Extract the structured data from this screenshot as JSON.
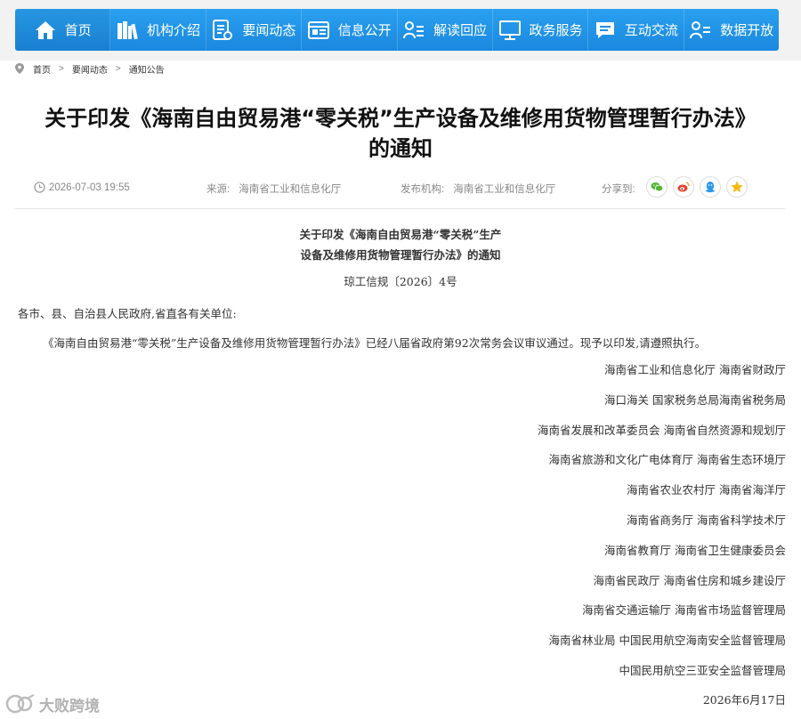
{
  "nav": {
    "items": [
      {
        "label": "首页",
        "icon": "home-icon"
      },
      {
        "label": "机构介绍",
        "icon": "books-icon"
      },
      {
        "label": "要闻动态",
        "icon": "news-icon"
      },
      {
        "label": "信息公开",
        "icon": "folder-icon"
      },
      {
        "label": "解读回应",
        "icon": "person-list-icon"
      },
      {
        "label": "政务服务",
        "icon": "monitor-icon"
      },
      {
        "label": "互动交流",
        "icon": "chat-icon"
      },
      {
        "label": "数据开放",
        "icon": "person-data-icon"
      }
    ],
    "color": "#1e90e6"
  },
  "breadcrumb": {
    "items": [
      "首页",
      "要闻动态",
      "通知公告"
    ]
  },
  "article": {
    "title_line1": "关于印发《海南自由贸易港“零关税”生产设备及维修用货物管理暂行办法》",
    "title_line2": "的通知",
    "date": "2026-07-03 19:55",
    "source_label": "来源:",
    "source": "海南省工业和信息化厅",
    "publisher_label": "发布机构:",
    "publisher": "海南省工业和信息化厅",
    "share_label": "分享到:",
    "share_icons": [
      "wechat-icon",
      "weibo-icon",
      "qq-icon",
      "favorite-star-icon"
    ]
  },
  "document": {
    "title_line1": "关于印发《海南自由贸易港“零关税”生产",
    "title_line2": "设备及维修用货物管理暂行办法》的通知",
    "doc_number": "琼工信规〔2026〕4号",
    "addressee": "各市、县、自治县人民政府,省直各有关单位:",
    "paragraph": "《海南自由贸易港“零关税”生产设备及维修用货物管理暂行办法》已经八届省政府第92次常务会议审议通过。现予以印发,请遵照执行。",
    "signatories": [
      "海南省工业和信息化厅  海南省财政厅",
      "海口海关  国家税务总局海南省税务局",
      "海南省发展和改革委员会  海南省自然资源和规划厅",
      "海南省旅游和文化广电体育厅  海南省生态环境厅",
      "海南省农业农村厅  海南省海洋厅",
      "海南省商务厅  海南省科学技术厅",
      "海南省教育厅  海南省卫生健康委员会",
      "海南省民政厅  海南省住房和城乡建设厅",
      "海南省交通运输厅  海南省市场监督管理局",
      "海南省林业局  中国民用航空海南安全监督管理局",
      "中国民用航空三亚安全监督管理局"
    ],
    "date": "2026年6月17日"
  },
  "watermark": {
    "text": "大败跨境"
  }
}
